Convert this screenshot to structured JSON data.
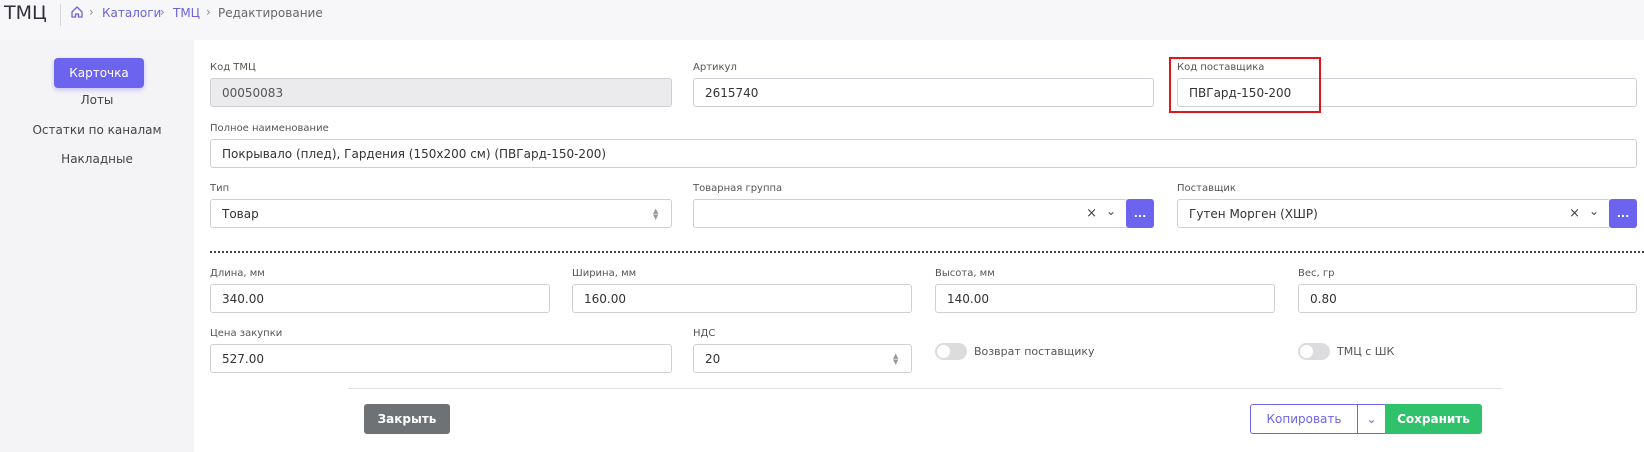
{
  "header": {
    "title": "ТМЦ",
    "breadcrumbs": [
      {
        "label": "Каталоги"
      },
      {
        "label": "ТМЦ"
      },
      {
        "label": "Редактирование"
      }
    ]
  },
  "sidebar": {
    "items": [
      {
        "label": "Карточка",
        "active": true
      },
      {
        "label": "Лоты"
      },
      {
        "label": "Остатки по каналам"
      },
      {
        "label": "Накладные"
      }
    ]
  },
  "form": {
    "code": {
      "label": "Код ТМЦ",
      "value": "00050083"
    },
    "article": {
      "label": "Артикул",
      "value": "2615740"
    },
    "supplier_code": {
      "label": "Код поставщика",
      "value": "ПВГард-150-200"
    },
    "full_name": {
      "label": "Полное наименование",
      "value": "Покрывало (плед), Гардения (150х200 см) (ПВГард-150-200)"
    },
    "type": {
      "label": "Тип",
      "value": "Товар"
    },
    "product_group": {
      "label": "Товарная группа",
      "value": ""
    },
    "supplier": {
      "label": "Поставщик",
      "value": "Гутен Морген (ХШР)"
    },
    "length": {
      "label": "Длина, мм",
      "value": "340.00"
    },
    "width": {
      "label": "Ширина, мм",
      "value": "160.00"
    },
    "height": {
      "label": "Высота, мм",
      "value": "140.00"
    },
    "weight": {
      "label": "Вес, гр",
      "value": "0.80"
    },
    "purchase_price": {
      "label": "Цена закупки",
      "value": "527.00"
    },
    "vat": {
      "label": "НДС",
      "value": "20"
    },
    "return_to_supplier": {
      "label": "Возврат поставщику",
      "on": false
    },
    "with_barcode": {
      "label": "ТМЦ с ШК",
      "on": false
    },
    "more_label": "..."
  },
  "actions": {
    "close": "Закрыть",
    "copy": "Копировать",
    "save": "Сохранить"
  },
  "colors": {
    "accent": "#6c63ef",
    "save": "#2fc26b",
    "close": "#6f7275",
    "highlight": "#e0161c"
  }
}
